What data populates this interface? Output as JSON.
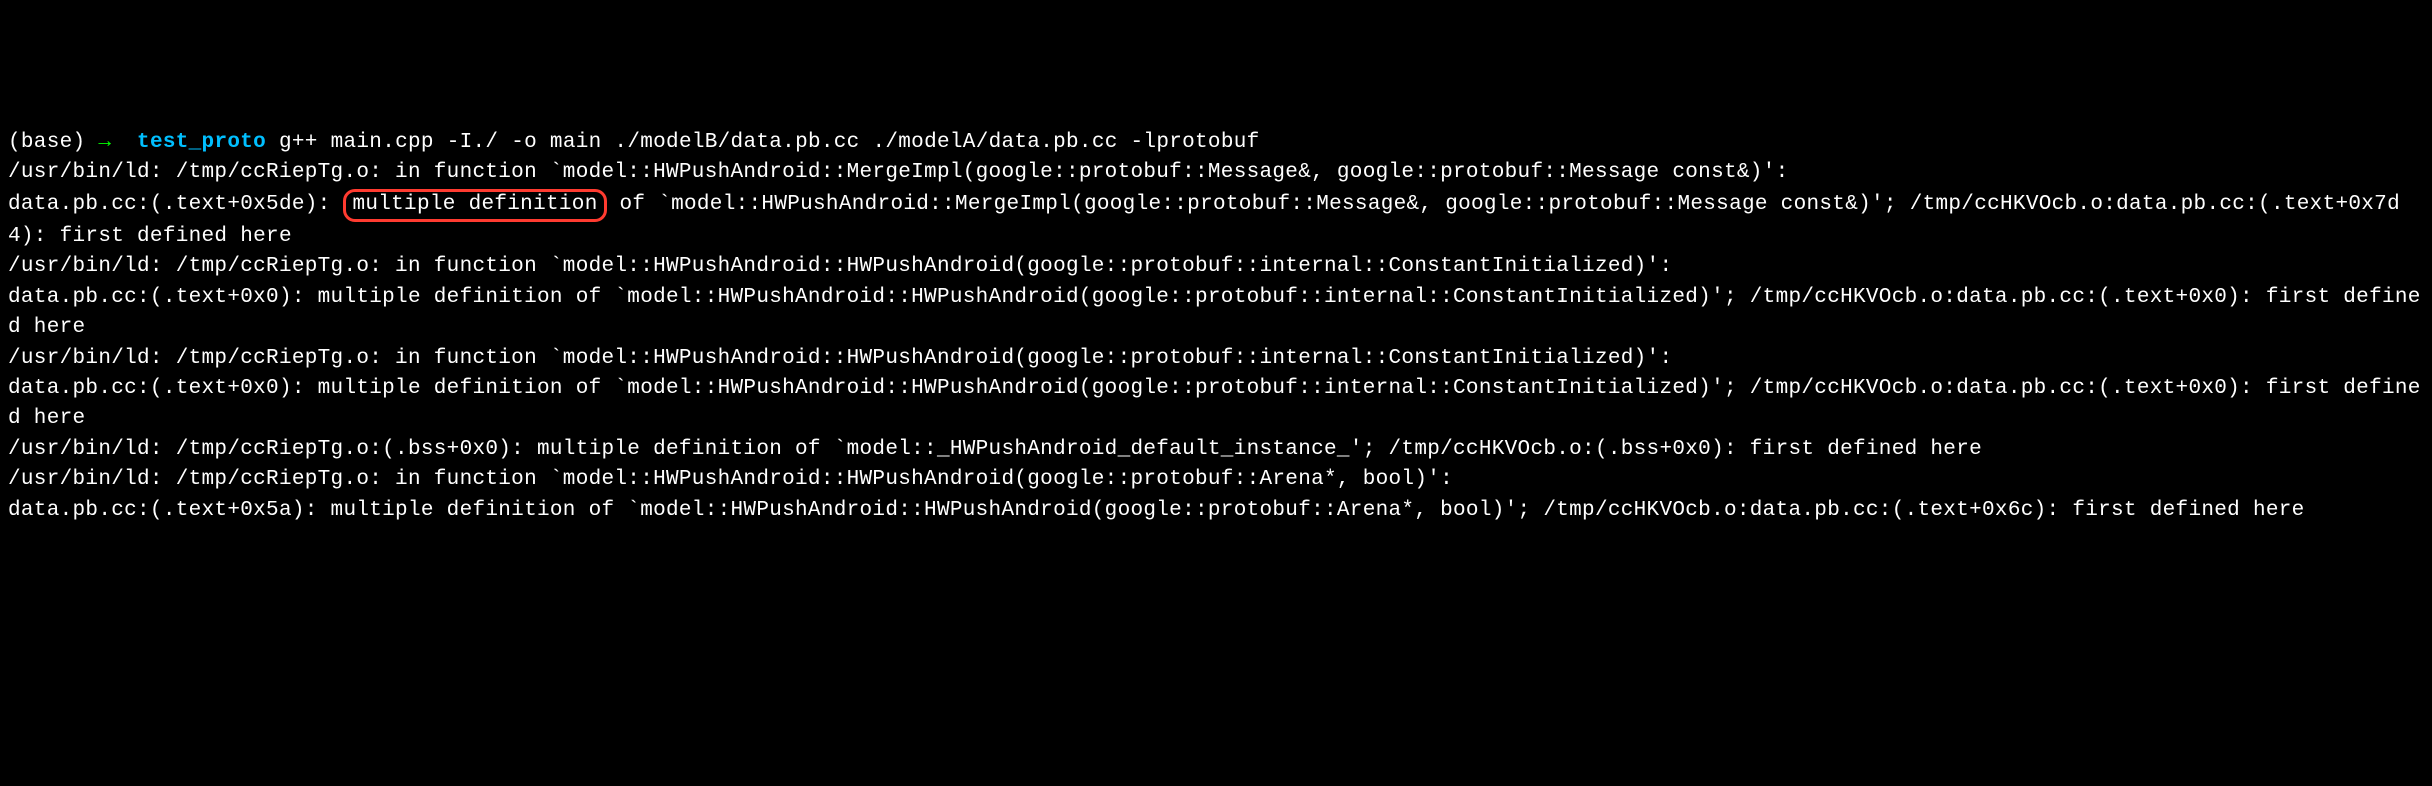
{
  "prompt": {
    "base": "(base)",
    "arrow": "→",
    "dir": "test_proto"
  },
  "command": "g++ main.cpp -I./ -o main ./modelB/data.pb.cc ./modelA/data.pb.cc -lprotobuf",
  "output": {
    "line1": "/usr/bin/ld: /tmp/ccRiepTg.o: in function `model::HWPushAndroid::MergeImpl(google::protobuf::Message&, google::protobuf::Message const&)':",
    "line2a": "data.pb.cc:(.text+0x5de): ",
    "line2highlight": "multiple definition",
    "line2b": " of `model::HWPushAndroid::MergeImpl(google::protobuf::Message&, google::protobuf::Message const&)'; /tmp/ccHKVOcb.o:data.pb.cc:(.text+0x7d4): first defined here",
    "line3": "/usr/bin/ld: /tmp/ccRiepTg.o: in function `model::HWPushAndroid::HWPushAndroid(google::protobuf::internal::ConstantInitialized)':",
    "line4": "data.pb.cc:(.text+0x0): multiple definition of `model::HWPushAndroid::HWPushAndroid(google::protobuf::internal::ConstantInitialized)'; /tmp/ccHKVOcb.o:data.pb.cc:(.text+0x0): first defined here",
    "line5": "/usr/bin/ld: /tmp/ccRiepTg.o: in function `model::HWPushAndroid::HWPushAndroid(google::protobuf::internal::ConstantInitialized)':",
    "line6": "data.pb.cc:(.text+0x0): multiple definition of `model::HWPushAndroid::HWPushAndroid(google::protobuf::internal::ConstantInitialized)'; /tmp/ccHKVOcb.o:data.pb.cc:(.text+0x0): first defined here",
    "line7": "/usr/bin/ld: /tmp/ccRiepTg.o:(.bss+0x0): multiple definition of `model::_HWPushAndroid_default_instance_'; /tmp/ccHKVOcb.o:(.bss+0x0): first defined here",
    "line8": "/usr/bin/ld: /tmp/ccRiepTg.o: in function `model::HWPushAndroid::HWPushAndroid(google::protobuf::Arena*, bool)':",
    "line9": "data.pb.cc:(.text+0x5a): multiple definition of `model::HWPushAndroid::HWPushAndroid(google::protobuf::Arena*, bool)'; /tmp/ccHKVOcb.o:data.pb.cc:(.text+0x6c): first defined here"
  }
}
